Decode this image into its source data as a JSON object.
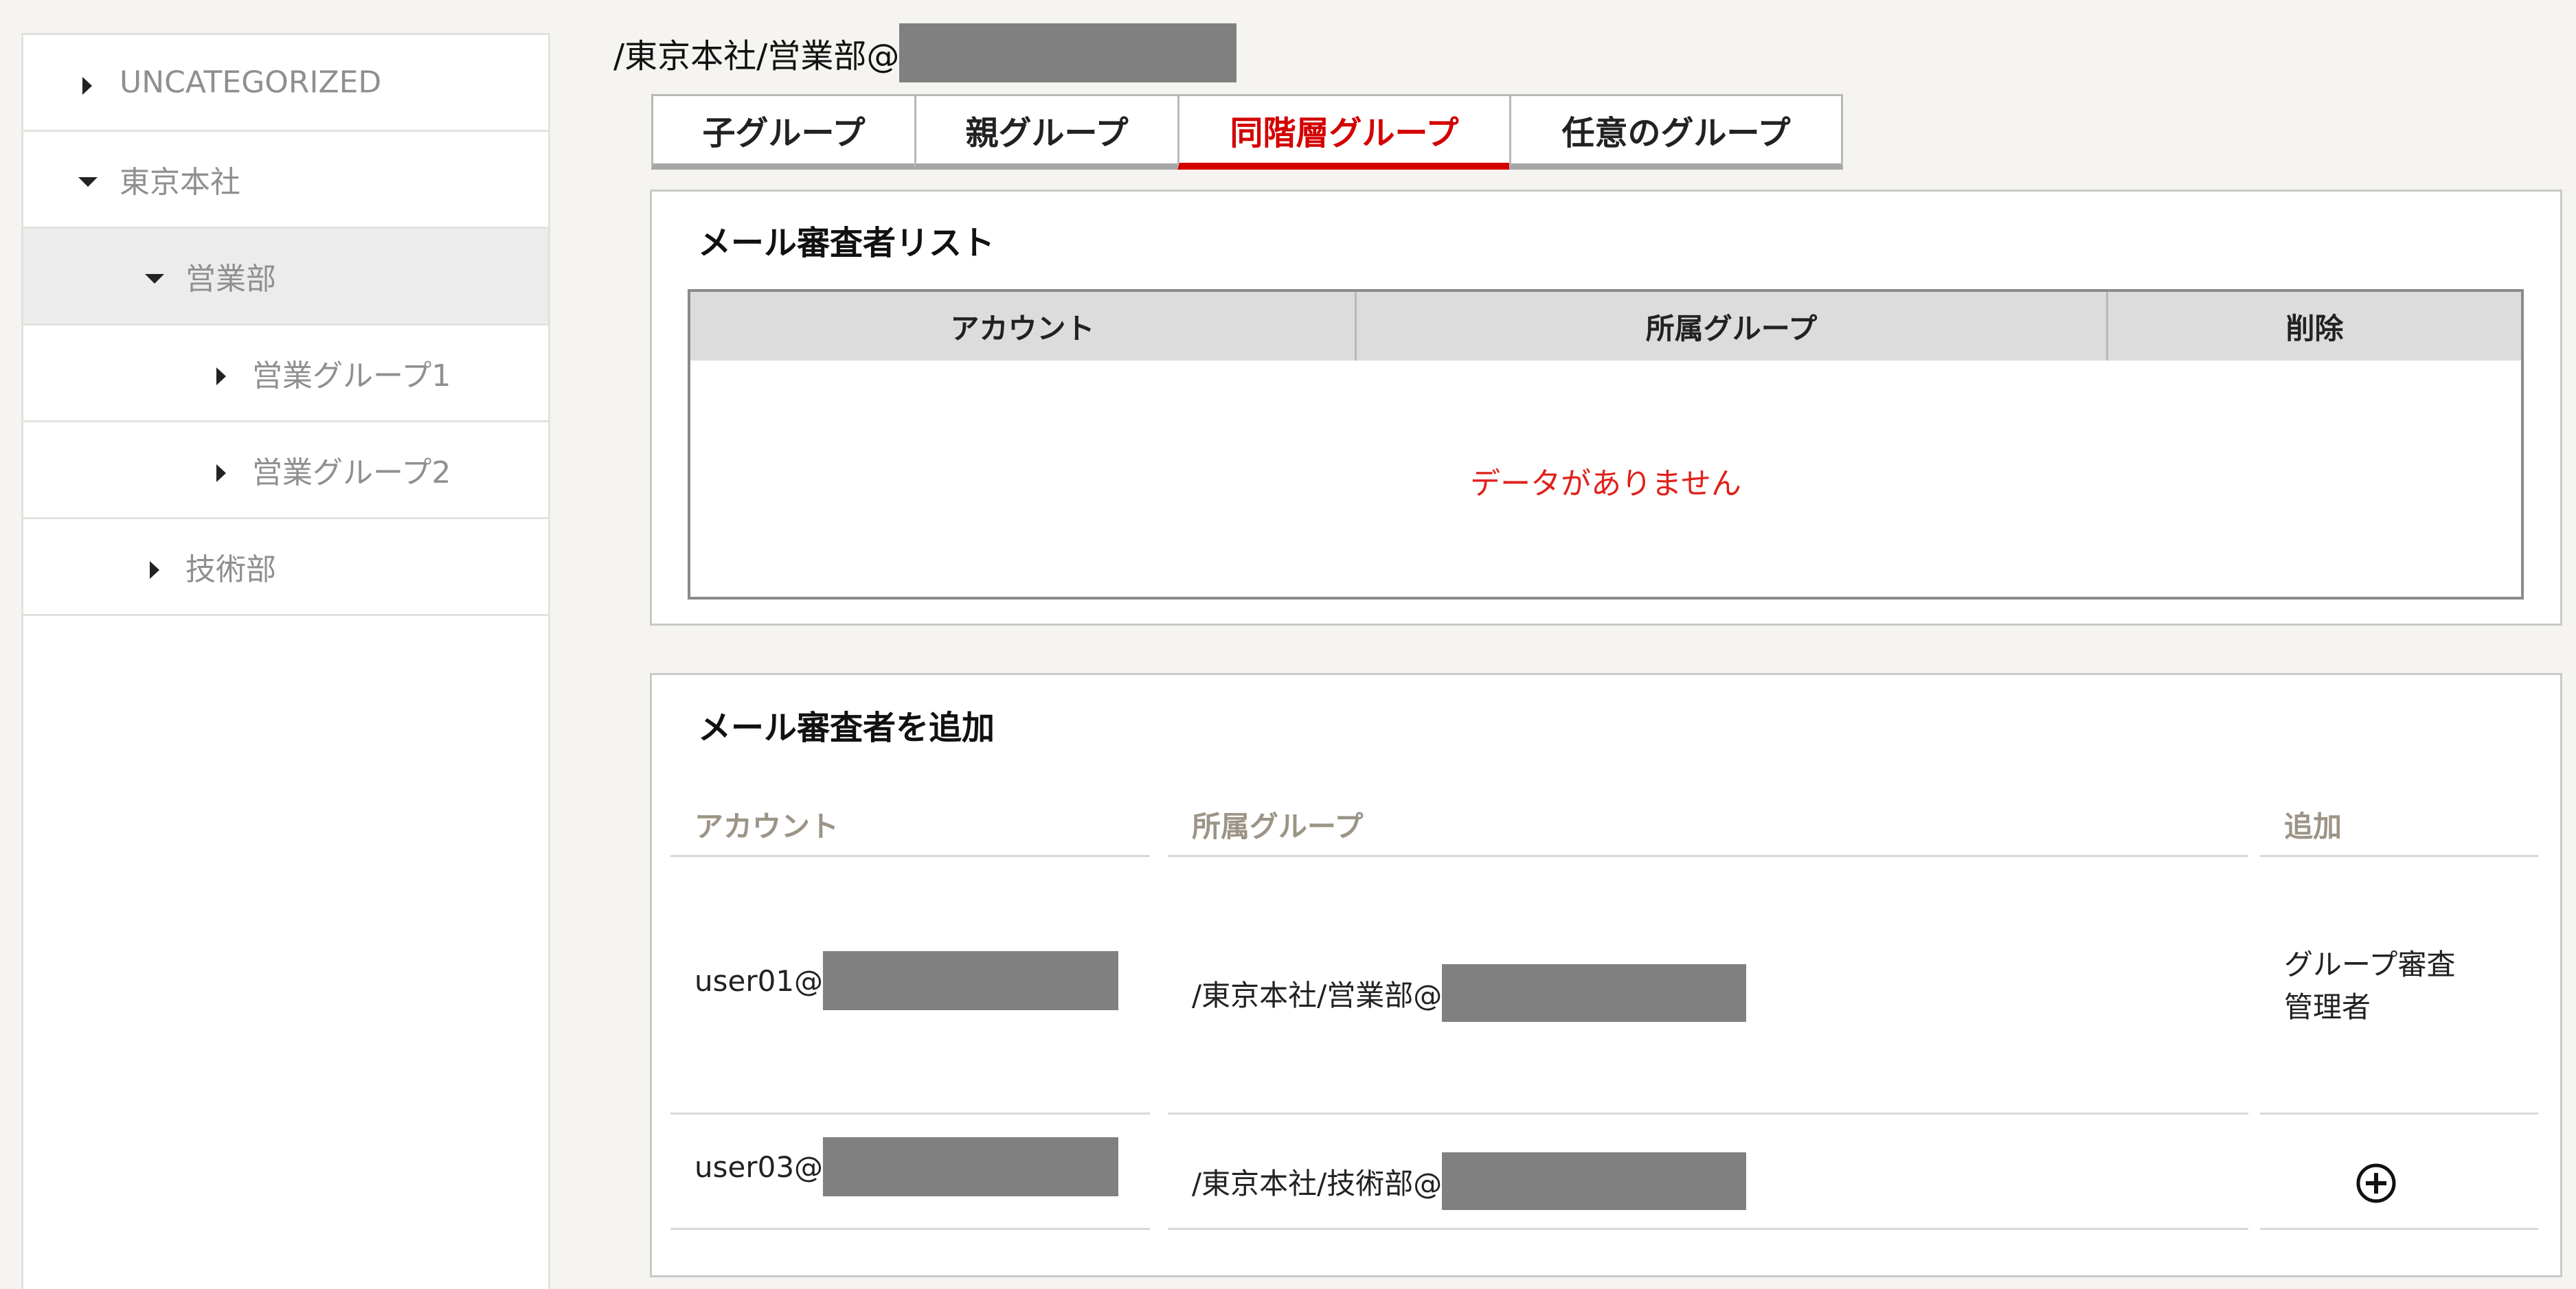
{
  "sidebar": {
    "items": [
      {
        "label": "UNCATEGORIZED",
        "expanded": false,
        "level": 0
      },
      {
        "label": "東京本社",
        "expanded": true,
        "level": 0
      },
      {
        "label": "営業部",
        "expanded": true,
        "level": 1,
        "selected": true
      },
      {
        "label": "営業グループ1",
        "expanded": false,
        "level": 2
      },
      {
        "label": "営業グループ2",
        "expanded": false,
        "level": 2
      },
      {
        "label": "技術部",
        "expanded": false,
        "level": 1
      }
    ]
  },
  "breadcrumb": {
    "path": "/東京本社/営業部@"
  },
  "tabs": [
    {
      "label": "子グループ",
      "active": false
    },
    {
      "label": "親グループ",
      "active": false
    },
    {
      "label": "同階層グループ",
      "active": true
    },
    {
      "label": "任意のグループ",
      "active": false
    }
  ],
  "reviewer_list": {
    "title": "メール審査者リスト",
    "columns": [
      "アカウント",
      "所属グループ",
      "削除"
    ],
    "empty_message": "データがありません"
  },
  "add_reviewer": {
    "title": "メール審査者を追加",
    "columns": [
      "アカウント",
      "所属グループ",
      "追加"
    ],
    "rows": [
      {
        "account": "user01@",
        "group": "/東京本社/営業部@",
        "add_status_line1": "グループ審査",
        "add_status_line2": "管理者"
      },
      {
        "account": "user03@",
        "group": "/東京本社/技術部@",
        "add_icon": "plus-circle-icon"
      }
    ]
  },
  "colors": {
    "accent": "#d40000",
    "empty_text": "#e0201a",
    "redaction": "#808080"
  }
}
